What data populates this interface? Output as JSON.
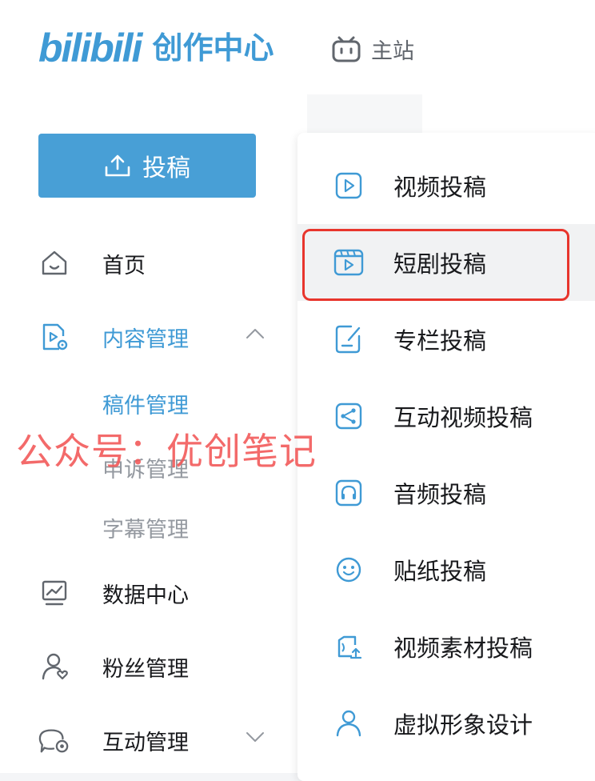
{
  "header": {
    "logo_brand": "bilibili",
    "logo_suffix": "创作中心",
    "main_site_label": "主站"
  },
  "sidebar": {
    "upload_button": "投稿",
    "items": [
      {
        "label": "首页",
        "icon": "home-icon"
      },
      {
        "label": "内容管理",
        "icon": "content-doc-icon",
        "expanded": true
      },
      {
        "label": "数据中心",
        "icon": "chart-monitor-icon"
      },
      {
        "label": "粉丝管理",
        "icon": "user-heart-icon"
      },
      {
        "label": "互动管理",
        "icon": "chat-icon"
      }
    ],
    "content_sub": [
      "稿件管理",
      "申诉管理",
      "字幕管理"
    ]
  },
  "upload_menu": {
    "items": [
      {
        "label": "视频投稿",
        "icon": "video-play-icon"
      },
      {
        "label": "短剧投稿",
        "icon": "film-play-icon"
      },
      {
        "label": "专栏投稿",
        "icon": "article-edit-icon"
      },
      {
        "label": "互动视频投稿",
        "icon": "share-node-icon"
      },
      {
        "label": "音频投稿",
        "icon": "headphones-icon"
      },
      {
        "label": "贴纸投稿",
        "icon": "smiley-icon"
      },
      {
        "label": "视频素材投稿",
        "icon": "material-upload-icon"
      },
      {
        "label": "虚拟形象设计",
        "icon": "avatar-person-icon"
      }
    ]
  },
  "watermark": "公众号：优创笔记",
  "colors": {
    "accent": "#3f9ad5",
    "button": "#489fd6",
    "highlight_border": "#e8352c",
    "muted": "#9499a0"
  }
}
